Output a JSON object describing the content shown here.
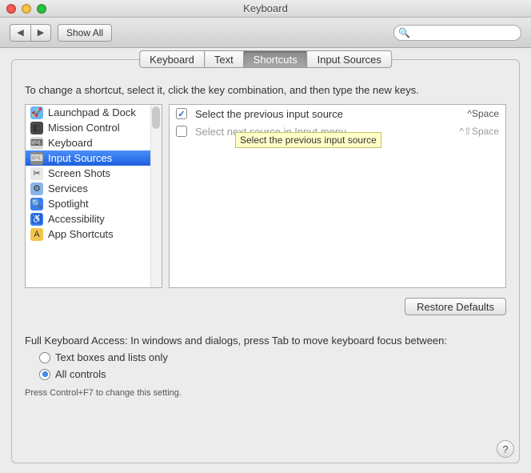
{
  "window": {
    "title": "Keyboard"
  },
  "toolbar": {
    "show_all": "Show All",
    "back_icon": "◀",
    "fwd_icon": "▶",
    "search_placeholder": ""
  },
  "tabs": [
    "Keyboard",
    "Text",
    "Shortcuts",
    "Input Sources"
  ],
  "tabs_selected_index": 2,
  "instruction": "To change a shortcut, select it, click the key combination, and then type the new keys.",
  "categories": [
    {
      "label": "Launchpad & Dock",
      "icon": "🚀",
      "bg": "#6fb3f2"
    },
    {
      "label": "Mission Control",
      "icon": "◧",
      "bg": "#4a4a4a"
    },
    {
      "label": "Keyboard",
      "icon": "⌨",
      "bg": "#d9d9d9"
    },
    {
      "label": "Input Sources",
      "icon": "⌨",
      "bg": "#8a8a8a",
      "selected": true
    },
    {
      "label": "Screen Shots",
      "icon": "✂",
      "bg": "#e8e8e8"
    },
    {
      "label": "Services",
      "icon": "⚙",
      "bg": "#89b6e6"
    },
    {
      "label": "Spotlight",
      "icon": "🔍",
      "bg": "#3a7ef0"
    },
    {
      "label": "Accessibility",
      "icon": "♿",
      "bg": "#3a7ef0"
    },
    {
      "label": "App Shortcuts",
      "icon": "A",
      "bg": "#f2c54a"
    }
  ],
  "shortcuts": [
    {
      "checked": true,
      "label": "Select the previous input source",
      "keys": "^Space",
      "dim": false
    },
    {
      "checked": false,
      "label": "Select next source in Input menu",
      "keys": "^⇧Space",
      "dim": true
    }
  ],
  "tooltip": "Select the previous input source",
  "restore_defaults": "Restore Defaults",
  "fka": {
    "title": "Full Keyboard Access: In windows and dialogs, press Tab to move keyboard focus between:",
    "opt1": "Text boxes and lists only",
    "opt2": "All controls",
    "selected": 1,
    "hint": "Press Control+F7 to change this setting."
  },
  "help": "?"
}
